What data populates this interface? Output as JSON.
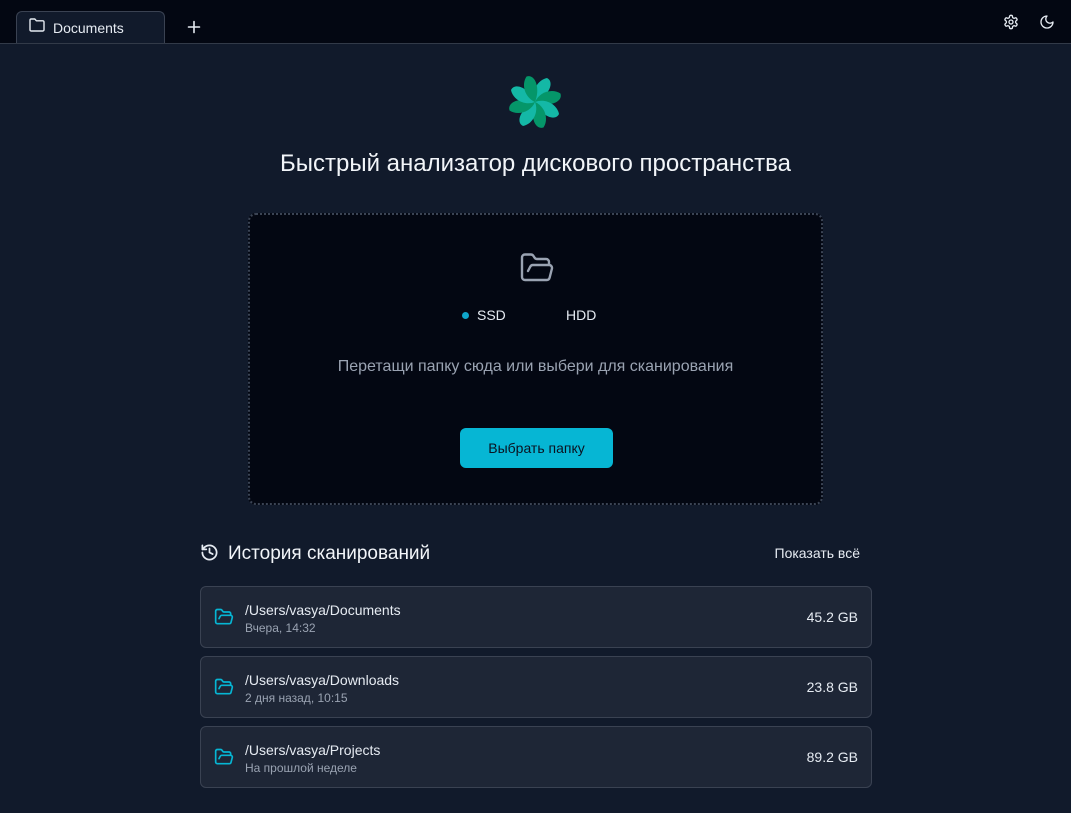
{
  "tabs": [
    {
      "label": "Documents",
      "icon": "folder-icon",
      "active": true
    }
  ],
  "toolbar": {
    "new_tab_icon": "plus-icon",
    "settings_icon": "gear-icon",
    "theme_icon": "moon-icon"
  },
  "hero": {
    "title": "Быстрый анализатор дискового пространства"
  },
  "dropzone": {
    "disk_types": [
      {
        "label": "SSD",
        "selected": true
      },
      {
        "label": "HDD",
        "selected": false
      }
    ],
    "hint": "Перетащи папку сюда или выбери для сканирования",
    "button_label": "Выбрать папку"
  },
  "history": {
    "title": "История сканирований",
    "show_all": "Показать всё",
    "items": [
      {
        "path": "/Users/vasya/Documents",
        "time": "Вчера, 14:32",
        "size": "45.2 GB"
      },
      {
        "path": "/Users/vasya/Downloads",
        "time": "2 дня назад, 10:15",
        "size": "23.8 GB"
      },
      {
        "path": "/Users/vasya/Projects",
        "time": "На прошлой неделе",
        "size": "89.2 GB"
      }
    ]
  },
  "colors": {
    "accent": "#06b6d4",
    "background": "#111a2b",
    "surface": "#030712",
    "card": "#1e2636",
    "logo_teal": "#14b8a6",
    "logo_green": "#059669"
  }
}
